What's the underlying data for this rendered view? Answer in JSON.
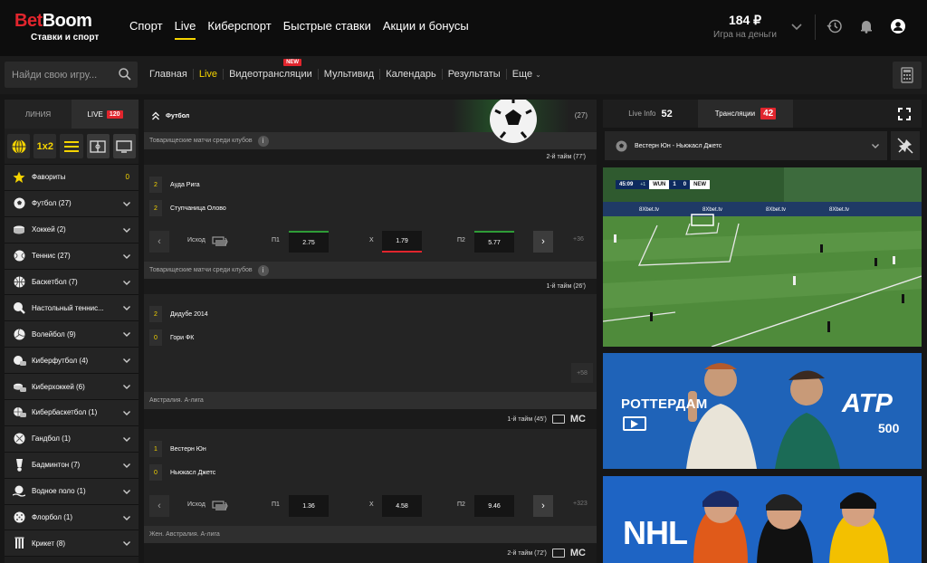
{
  "header": {
    "logo": {
      "brand_main": "Bet",
      "brand_accent": "Boom",
      "tagline": "Ставки и спорт"
    },
    "nav": [
      {
        "label": "Спорт",
        "active": false
      },
      {
        "label": "Live",
        "active": true
      },
      {
        "label": "Киберспорт",
        "active": false
      },
      {
        "label": "Быстрые ставки",
        "active": false
      },
      {
        "label": "Акции и бонусы",
        "active": false
      }
    ],
    "balance": {
      "amount": "184 ₽",
      "note": "Игра на деньги"
    },
    "icons": [
      "chevron-down-icon",
      "history-icon",
      "bell-icon",
      "user-icon"
    ]
  },
  "subbar": {
    "search_placeholder": "Найди свою игру...",
    "links": [
      {
        "label": "Главная",
        "active": false
      },
      {
        "label": "Live",
        "active": true
      },
      {
        "label": "Видеотрансляции",
        "active": false,
        "badge": "NEW"
      },
      {
        "label": "Мультивид",
        "active": false
      },
      {
        "label": "Календарь",
        "active": false
      },
      {
        "label": "Результаты",
        "active": false
      },
      {
        "label": "Еще",
        "active": false
      }
    ]
  },
  "sidebar": {
    "tabs": [
      {
        "label": "ЛИНИЯ"
      },
      {
        "label": "LIVE",
        "badge": "120"
      }
    ],
    "filters": [
      "globe-icon",
      "1x2",
      "list-icon",
      "field-icon",
      "tv-icon"
    ],
    "items": [
      {
        "label": "Фавориты",
        "count": "0",
        "icon": "star-icon"
      },
      {
        "label": "Футбол (27)",
        "icon": "football-icon"
      },
      {
        "label": "Хоккей (2)",
        "icon": "hockey-icon"
      },
      {
        "label": "Теннис (27)",
        "icon": "tennis-icon"
      },
      {
        "label": "Баскетбол (7)",
        "icon": "basketball-icon"
      },
      {
        "label": "Настольный теннис...",
        "icon": "table-tennis-icon"
      },
      {
        "label": "Волейбол (9)",
        "icon": "volleyball-icon"
      },
      {
        "label": "Киберфутбол (4)",
        "icon": "cyberfootball-icon"
      },
      {
        "label": "Киберхоккей (6)",
        "icon": "cyberhockey-icon"
      },
      {
        "label": "Кибербаскетбол (1)",
        "icon": "cyberbasketball-icon"
      },
      {
        "label": "Гандбол (1)",
        "icon": "handball-icon"
      },
      {
        "label": "Бадминтон (7)",
        "icon": "badminton-icon"
      },
      {
        "label": "Водное поло (1)",
        "icon": "waterpolo-icon"
      },
      {
        "label": "Флорбол (1)",
        "icon": "floorball-icon"
      },
      {
        "label": "Крикет (8)",
        "icon": "cricket-icon"
      }
    ]
  },
  "center": {
    "sport": {
      "label": "Футбол",
      "count": "(27)"
    },
    "matches": [
      {
        "league": "Товарищеские матчи среди клубов",
        "period": "2-й тайм  (77')",
        "teams": [
          {
            "score": "2",
            "name": "Ауда Рига"
          },
          {
            "score": "2",
            "name": "Ступчаница Олово"
          }
        ],
        "odds": {
          "label": "Исход",
          "p1_label": "П1",
          "p1": "2.75",
          "x_label": "X",
          "x": "1.79",
          "p2_label": "П2",
          "p2": "5.77",
          "more": "+36"
        }
      },
      {
        "league": "Товарищеские матчи среди клубов",
        "period": "1-й тайм  (26')",
        "teams": [
          {
            "score": "2",
            "name": "Дидубе 2014"
          },
          {
            "score": "0",
            "name": "Гори ФК"
          }
        ],
        "more": "+58"
      },
      {
        "league": "Австралия. А-лига",
        "period": "1-й тайм  (45')",
        "mc": "MC",
        "teams": [
          {
            "score": "1",
            "name": "Вестерн Юн"
          },
          {
            "score": "0",
            "name": "Ньюкасл Джетс"
          }
        ],
        "odds": {
          "label": "Исход",
          "p1_label": "П1",
          "p1": "1.36",
          "x_label": "X",
          "x": "4.58",
          "p2_label": "П2",
          "p2": "9.46",
          "more": "+323"
        }
      },
      {
        "league": "Жен. Австралия. А-лига",
        "period": "2-й тайм  (72')",
        "mc": "MC"
      }
    ]
  },
  "right": {
    "tabs": [
      {
        "label": "Live Info",
        "count": "52"
      },
      {
        "label": "Трансляции",
        "count": "42"
      }
    ],
    "selected_match": "Вестерн Юн - Ньюкасл Джетс",
    "video": {
      "time": "45:09",
      "plus": "+1",
      "home": "WUN",
      "score_home": "1",
      "score_away": "0",
      "away": "NEW"
    },
    "banners": {
      "atp": {
        "city": "РОТТЕРДАМ",
        "logo": "ATP",
        "number": "500"
      },
      "nhl": {
        "logo": "NHL"
      }
    }
  }
}
